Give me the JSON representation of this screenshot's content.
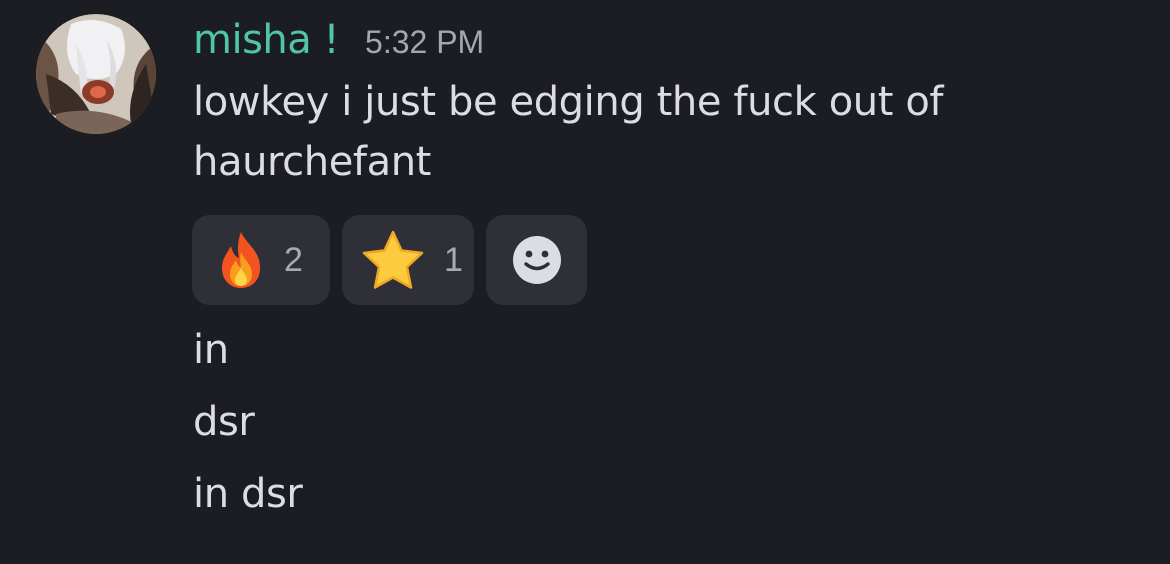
{
  "author": {
    "username": "misha !",
    "username_color": "#4fc6a8",
    "timestamp": "5:32 PM",
    "avatar_icon": "anime-avatar-image"
  },
  "messages": [
    {
      "text": "lowkey i just be edging the fuck out of haurchefant"
    },
    {
      "text": "in"
    },
    {
      "text": "dsr"
    },
    {
      "text": "in dsr"
    }
  ],
  "reactions": [
    {
      "emoji": "fire-icon",
      "count": "2"
    },
    {
      "emoji": "star-icon",
      "count": "1"
    },
    {
      "emoji": "add-reaction-smiley-icon"
    }
  ],
  "colors": {
    "background": "#1c1d22",
    "reaction_bg": "#2f3037",
    "text": "#dcdde2",
    "muted": "#a5a7b0"
  }
}
